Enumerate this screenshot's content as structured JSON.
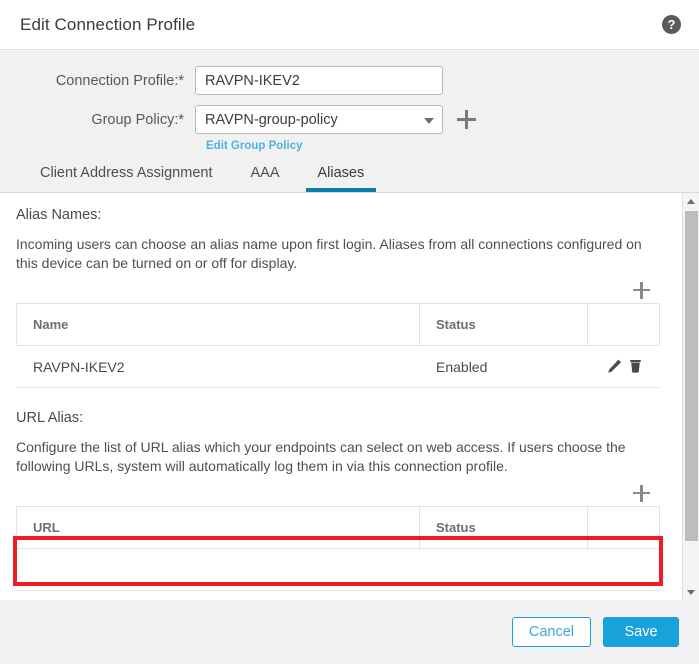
{
  "header": {
    "title": "Edit Connection Profile",
    "help_icon": "help-circle-icon",
    "help_glyph": "?"
  },
  "form": {
    "connection_profile": {
      "label": "Connection Profile:*",
      "value": "RAVPN-IKEV2",
      "placeholder": ""
    },
    "group_policy": {
      "label": "Group Policy:*",
      "value": "RAVPN-group-policy",
      "add_icon": "plus-icon",
      "edit_link": "Edit Group Policy"
    }
  },
  "tabs": [
    {
      "label": "Client Address Assignment",
      "active": false
    },
    {
      "label": "AAA",
      "active": false
    },
    {
      "label": "Aliases",
      "active": true
    }
  ],
  "alias_names": {
    "title": "Alias Names:",
    "description": "Incoming users can choose an alias name upon first login. Aliases from all connections configured on this device can be turned on or off for display.",
    "add_icon": "plus-icon",
    "columns": [
      "Name",
      "Status",
      ""
    ],
    "rows": [
      {
        "name": "RAVPN-IKEV2",
        "status": "Enabled",
        "edit_icon": "pencil-icon",
        "delete_icon": "trash-icon"
      }
    ]
  },
  "url_alias": {
    "title": "URL Alias:",
    "description": "Configure the list of URL alias which your endpoints can select on web access. If users choose the following URLs, system will automatically log them in via this connection profile.",
    "add_icon": "plus-icon",
    "columns": [
      "URL",
      "Status",
      ""
    ],
    "rows": []
  },
  "scrollbar": {
    "up_icon": "chevron-up-icon",
    "down_icon": "chevron-down-icon"
  },
  "footer": {
    "cancel_label": "Cancel",
    "save_label": "Save"
  },
  "annotation": {
    "type": "highlight-rectangle",
    "color": "#ee1c25"
  },
  "colors": {
    "accent_blue": "#17a2d9",
    "tab_active": "#0d7ca8",
    "link_blue": "#4ab4e6",
    "annotation_red": "#ee1c25",
    "panel_bg": "#f1f1f1"
  }
}
